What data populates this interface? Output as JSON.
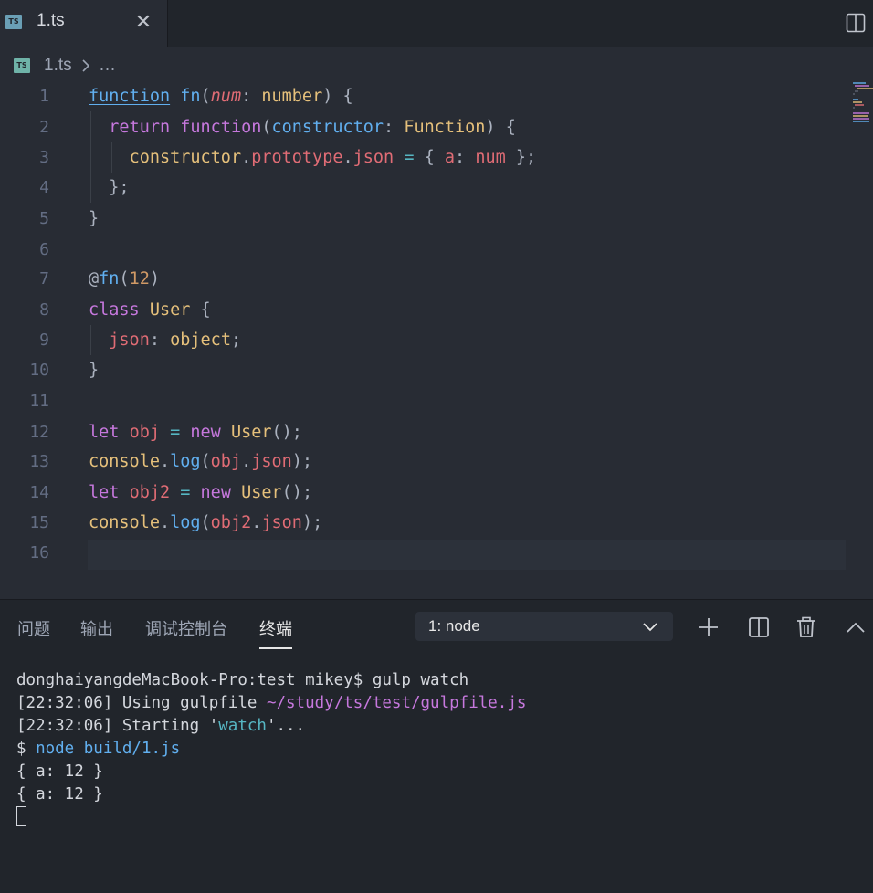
{
  "tab": {
    "icon": "typescript-file-icon",
    "icon_text": "TS",
    "label": "1.ts",
    "close_glyph": "✕"
  },
  "breadcrumb": {
    "icon_text": "TS",
    "file": "1.ts",
    "more": "…"
  },
  "editor": {
    "line_numbers": [
      "1",
      "2",
      "3",
      "4",
      "5",
      "6",
      "7",
      "8",
      "9",
      "10",
      "11",
      "12",
      "13",
      "14",
      "15",
      "16"
    ],
    "current_line": 16
  },
  "panel": {
    "tabs": [
      {
        "label": "问题",
        "active": false
      },
      {
        "label": "输出",
        "active": false
      },
      {
        "label": "调试控制台",
        "active": false
      },
      {
        "label": "终端",
        "active": true
      }
    ],
    "terminal_selector": "1: node",
    "actions": [
      "add-terminal-icon",
      "split-terminal-icon",
      "trash-icon",
      "maximize-panel-icon"
    ]
  },
  "terminal": {
    "prompt": "donghaiyangdeMacBook-Pro:test mikey$ gulp watch",
    "t1": "[22:32:06]",
    "using": " Using gulpfile ",
    "gulpfile": "~/study/ts/test/gulpfile.js",
    "t2": "[22:32:06]",
    "starting": " Starting '",
    "task": "watch",
    "starting_end": "'...",
    "dollar": "$ ",
    "node_cmd": "node build/1.js",
    "out1": "{ a: 12 }",
    "out2": "{ a: 12 }"
  },
  "colors": {
    "keyword": "#c678dd",
    "function": "#61afef",
    "param": "#e06c75",
    "type": "#e5c07b",
    "number": "#d19a66",
    "operator": "#56b6c2"
  }
}
